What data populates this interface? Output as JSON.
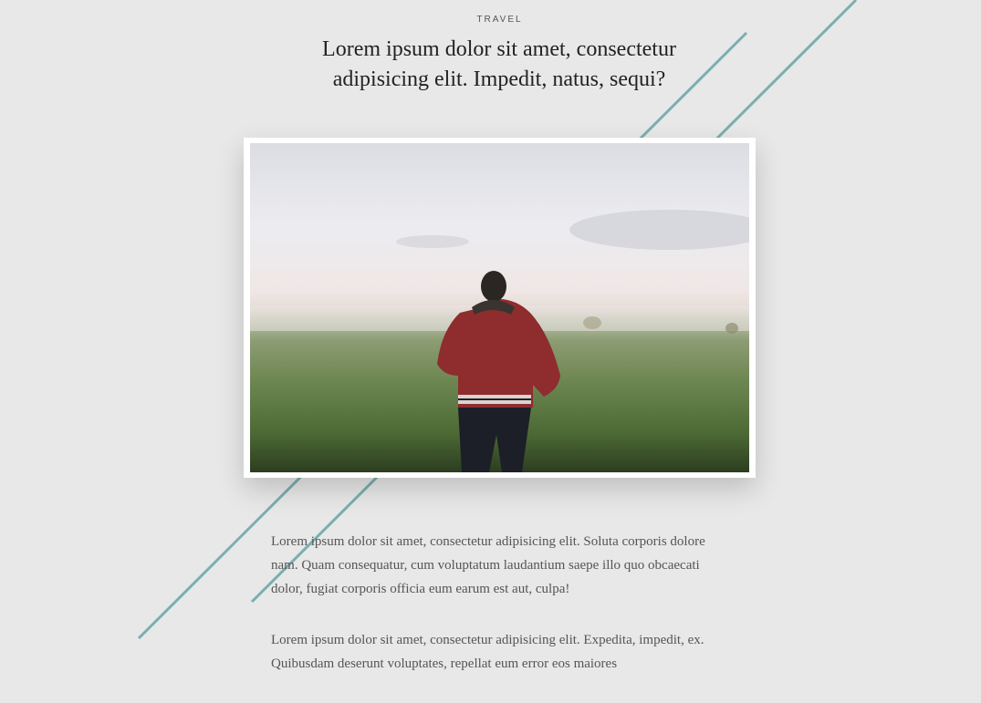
{
  "article": {
    "category": "TRAVEL",
    "title": "Lorem ipsum dolor sit amet, consectetur adipisicing elit. Impedit, natus, sequi?",
    "image": {
      "description_icon": "man-in-red-jacket-in-foggy-field-photo"
    },
    "paragraphs": [
      "Lorem ipsum dolor sit amet, consectetur adipisicing elit. Soluta corporis dolore nam. Quam consequatur, cum voluptatum laudantium saepe illo quo obcaecati dolor, fugiat corporis officia eum earum est aut, culpa!",
      "Lorem ipsum dolor sit amet, consectetur adipisicing elit. Expedita, impedit, ex. Quibusdam deserunt voluptates, repellat eum error eos maiores"
    ]
  },
  "colors": {
    "background": "#e8e8e8",
    "accent_line": "#7aafae",
    "text": "#555555"
  }
}
